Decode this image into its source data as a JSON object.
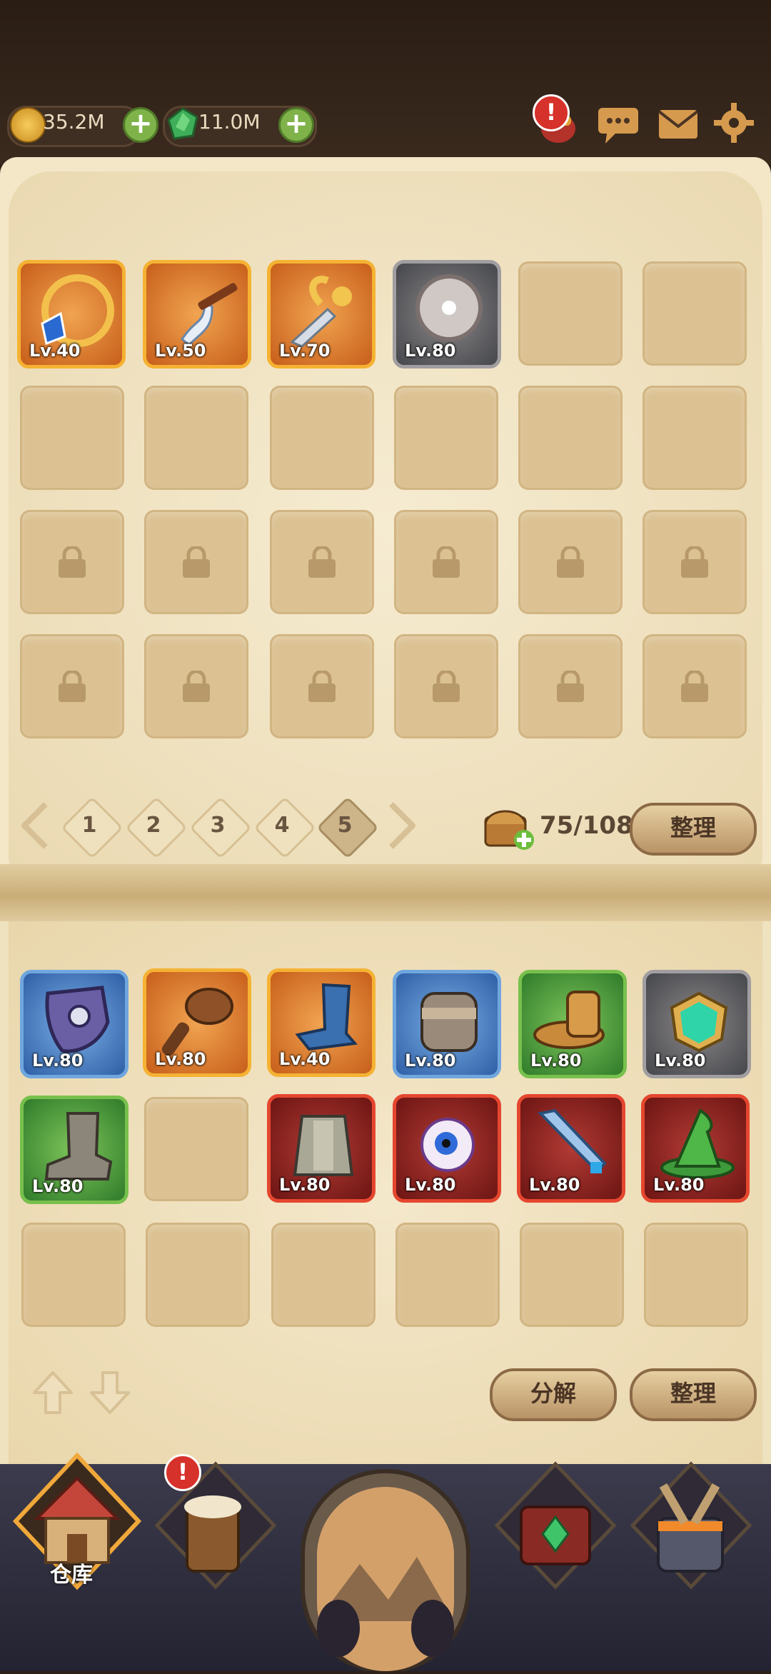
{
  "resources": {
    "coins": "35.2M",
    "gems": "11.0M"
  },
  "top_icons": [
    "event-icon",
    "chat-icon",
    "mail-icon",
    "settings-icon"
  ],
  "equipped": {
    "items": [
      {
        "name": "ring-blue-gem",
        "level": "Lv.40",
        "rarity": "orange"
      },
      {
        "name": "curved-sword",
        "level": "Lv.50",
        "rarity": "orange"
      },
      {
        "name": "golden-dagger",
        "level": "Lv.70",
        "rarity": "orange"
      },
      {
        "name": "gray-shield-round",
        "level": "Lv.80",
        "rarity": "gray"
      }
    ]
  },
  "pagination": {
    "pages": [
      "1",
      "2",
      "3",
      "4",
      "5"
    ],
    "active": "5",
    "capacity": "75/108",
    "sort_label": "整理"
  },
  "inventory": {
    "items": [
      {
        "name": "purple-shield",
        "level": "Lv.80",
        "rarity": "blue"
      },
      {
        "name": "spiked-club",
        "level": "Lv.80",
        "rarity": "orange"
      },
      {
        "name": "blue-boot",
        "level": "Lv.40",
        "rarity": "orange"
      },
      {
        "name": "armor-vest",
        "level": "Lv.80",
        "rarity": "blue"
      },
      {
        "name": "feather-hat",
        "level": "Lv.80",
        "rarity": "green"
      },
      {
        "name": "jade-amulet",
        "level": "Lv.80",
        "rarity": "gray"
      },
      {
        "name": "leather-boot",
        "level": "Lv.80",
        "rarity": "green"
      },
      {
        "name": "chest-armor",
        "level": "Lv.80",
        "rarity": "red"
      },
      {
        "name": "eye-orb",
        "level": "Lv.80",
        "rarity": "red"
      },
      {
        "name": "crystal-sword",
        "level": "Lv.80",
        "rarity": "red"
      },
      {
        "name": "wizard-hat",
        "level": "Lv.80",
        "rarity": "red"
      }
    ],
    "decompose_label": "分解",
    "sort_label": "整理"
  },
  "nav": {
    "warehouse_label": "仓库"
  },
  "colors": {
    "accent": "#f5b233",
    "parchment": "#efe2be",
    "slot": "#dcc293"
  }
}
